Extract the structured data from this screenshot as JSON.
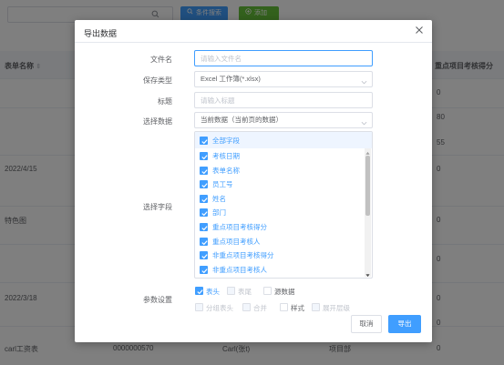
{
  "background": {
    "search_button_label": "条件搜索",
    "add_button_label": "添加",
    "columns": {
      "form_name": "表单名称",
      "key_score": "重点项目考核得分"
    },
    "cells": {
      "date1": "2022/4/15",
      "special": "特色图",
      "date2": "2022/3/18",
      "last_name": "carl工资表",
      "last_code": "0000000570",
      "last_person": "Carl(张t)",
      "last_dept": "项目部",
      "score_0a": "0",
      "score_80": "80",
      "score_55": "55",
      "score_0b": "0",
      "score_0c": "0",
      "score_0d": "0",
      "score_0e": "0",
      "score_0f": "0",
      "score_0g": "0"
    }
  },
  "dialog": {
    "title": "导出数据",
    "file_name_label": "文件名",
    "file_name_placeholder": "请输入文件名",
    "save_type_label": "保存类型",
    "save_type_value": "Excel 工作簿(*.xlsx)",
    "title_label": "标题",
    "title_placeholder": "请输入标题",
    "select_data_label": "选择数据",
    "select_data_value": "当前数据（当前页的数据）",
    "select_fields_label": "选择字段",
    "all_fields_label": "全部字段",
    "fields": [
      "考核日期",
      "表单名称",
      "员工号",
      "姓名",
      "部门",
      "重点项目考核得分",
      "重点项目考核人",
      "非重点项目考核得分",
      "非重点项目考核人"
    ],
    "params_label": "参数设置",
    "params_row1": [
      {
        "label": "表头",
        "checked": true,
        "disabled": false
      },
      {
        "label": "表尾",
        "checked": false,
        "disabled": true
      },
      {
        "label": "源数据",
        "checked": false,
        "disabled": false
      }
    ],
    "params_row2": [
      {
        "label": "分组表头",
        "checked": false,
        "disabled": true
      },
      {
        "label": "合并",
        "checked": false,
        "disabled": true
      },
      {
        "label": "样式",
        "checked": false,
        "disabled": false
      },
      {
        "label": "展开层级",
        "checked": false,
        "disabled": true
      }
    ],
    "cancel_label": "取消",
    "export_label": "导出"
  },
  "colors": {
    "accent": "#409eff",
    "green": "#67c23a",
    "overlay": "rgba(0,0,0,0.5)"
  }
}
